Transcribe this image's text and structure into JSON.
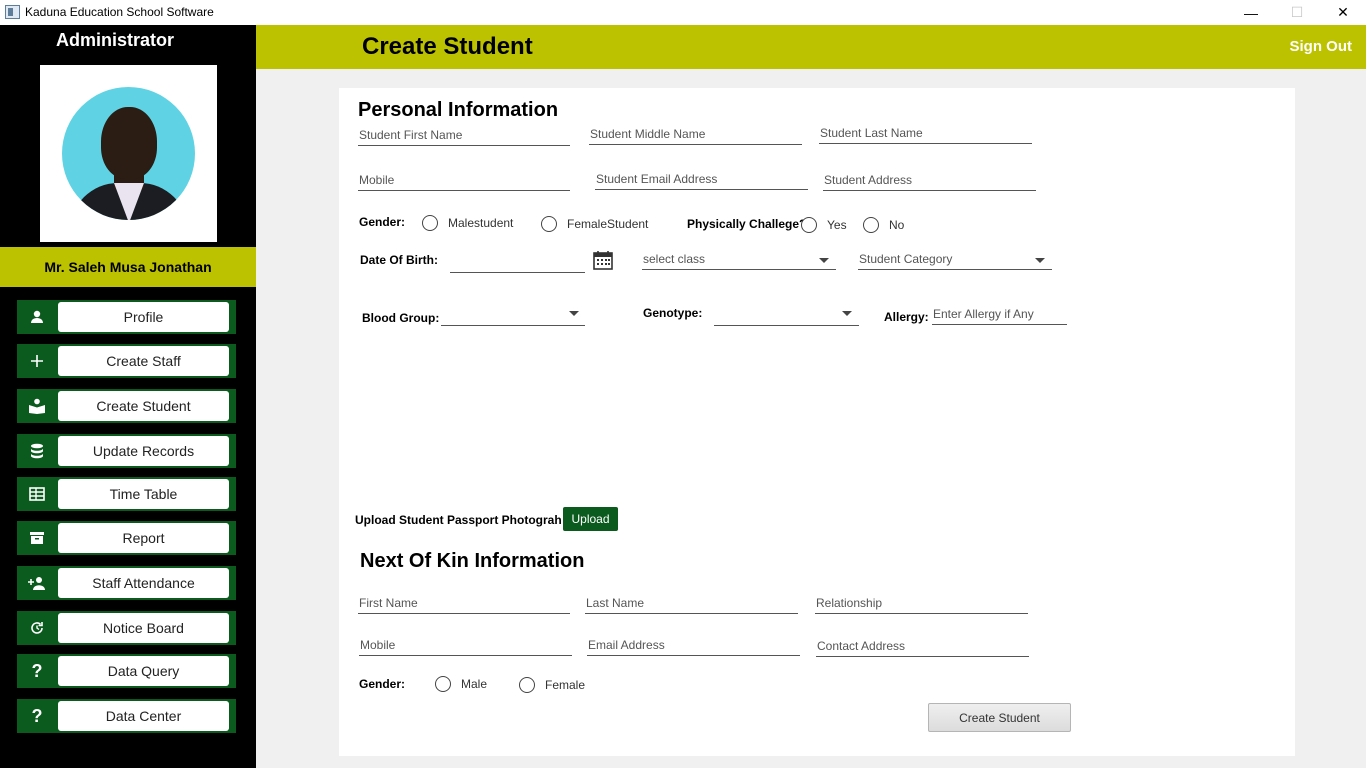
{
  "window": {
    "title": "Kaduna Education School Software",
    "minimize": "—",
    "maximize": "☐",
    "close": "✕"
  },
  "sidebar": {
    "role": "Administrator",
    "user_name": "Mr.  Saleh Musa Jonathan",
    "items": [
      {
        "label": "Profile",
        "icon": "person-icon"
      },
      {
        "label": "Create Staff",
        "icon": "plus-icon"
      },
      {
        "label": "Create Student",
        "icon": "reader-icon"
      },
      {
        "label": "Update Records",
        "icon": "database-icon"
      },
      {
        "label": "Time Table",
        "icon": "table-icon"
      },
      {
        "label": "Report",
        "icon": "archive-icon"
      },
      {
        "label": "Staff Attendance",
        "icon": "person-add-icon"
      },
      {
        "label": "Notice Board",
        "icon": "refresh-icon"
      },
      {
        "label": "Data Query",
        "icon": "question-icon"
      },
      {
        "label": "Data Center",
        "icon": "question-icon"
      }
    ]
  },
  "header": {
    "title": "Create Student",
    "sign_out": "Sign Out"
  },
  "personal": {
    "title": "Personal Information",
    "first_name": "Student First Name",
    "middle_name": "Student Middle Name",
    "last_name": "Student Last Name",
    "mobile": "Mobile",
    "email": "Student Email Address",
    "address": "Student Address",
    "gender_label": "Gender:",
    "gender_male": "Malestudent",
    "gender_female": "FemaleStudent",
    "challenged_label": "Physically Challege?",
    "challenged_yes": "Yes",
    "challenged_no": "No",
    "dob_label": "Date Of Birth:",
    "dob_value": "",
    "class_select": "select class",
    "category_select": "Student Category",
    "blood_label": "Blood Group:",
    "blood_value": "",
    "genotype_label": "Genotype:",
    "genotype_value": "",
    "allergy_label": "Allergy:",
    "allergy_placeholder": "Enter Allergy if Any"
  },
  "upload": {
    "label": "Upload Student Passport Photograh",
    "button": "Upload"
  },
  "kin": {
    "title": "Next Of Kin Information",
    "first_name": "First Name",
    "last_name": "Last Name",
    "relationship": "Relationship",
    "mobile": "Mobile",
    "email": "Email Address",
    "address": "Contact Address",
    "gender_label": "Gender:",
    "gender_male": "Male",
    "gender_female": "Female"
  },
  "submit": "Create Student",
  "colors": {
    "accent": "#bcc200",
    "nav_green": "#0b5a1e",
    "sidebar_bg": "#000000"
  }
}
